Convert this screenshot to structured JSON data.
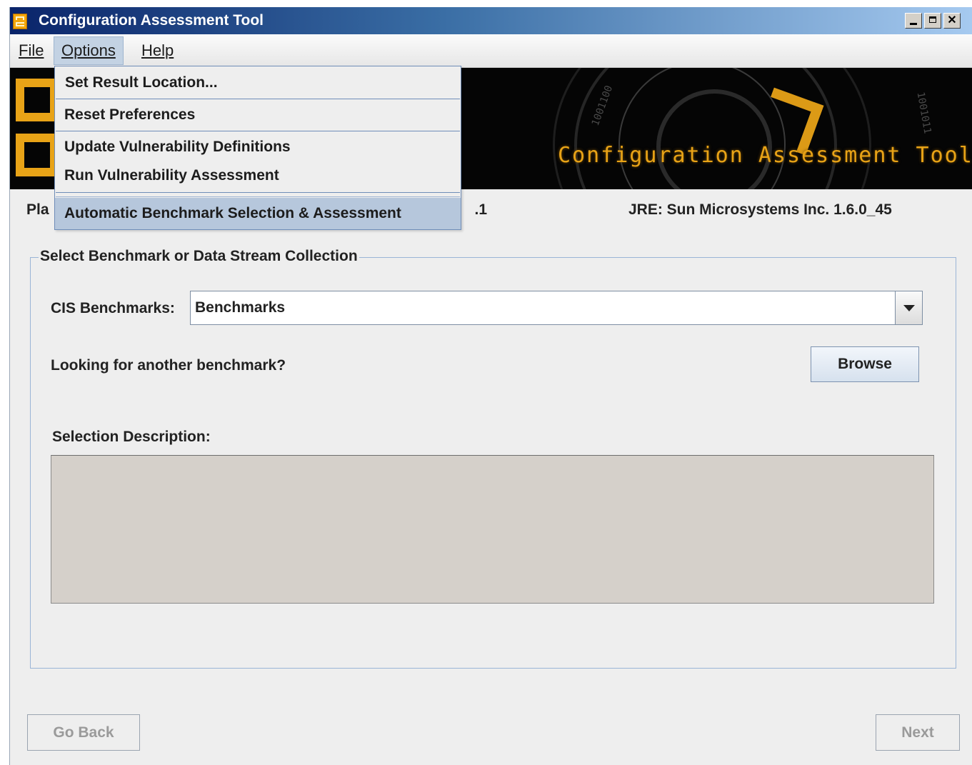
{
  "window": {
    "title": "Configuration Assessment Tool"
  },
  "menubar": {
    "file": "File",
    "options": "Options",
    "help": "Help"
  },
  "options_menu": {
    "items": [
      "Set Result Location...",
      "Reset Preferences",
      "Update Vulnerability Definitions",
      "Run Vulnerability Assessment",
      "Automatic Benchmark Selection & Assessment"
    ],
    "highlighted": "Automatic Benchmark Selection & Assessment"
  },
  "banner": {
    "title": "Configuration Assessment Tool"
  },
  "info": {
    "platform_prefix": "Pla",
    "platform_suffix": ".1",
    "jre": "JRE:  Sun Microsystems Inc. 1.6.0_45"
  },
  "selection_group": {
    "legend": "Select Benchmark or Data Stream Collection",
    "cis_label": "CIS Benchmarks:",
    "cis_value": "Benchmarks",
    "looking_label": "Looking for another benchmark?",
    "browse_label": "Browse",
    "description_label": "Selection Description:",
    "description_text": ""
  },
  "footer": {
    "go_back_label": "Go Back",
    "next_label": "Next"
  },
  "colors": {
    "accent": "#e8a317",
    "menu_highlight": "#b6c7dc"
  }
}
